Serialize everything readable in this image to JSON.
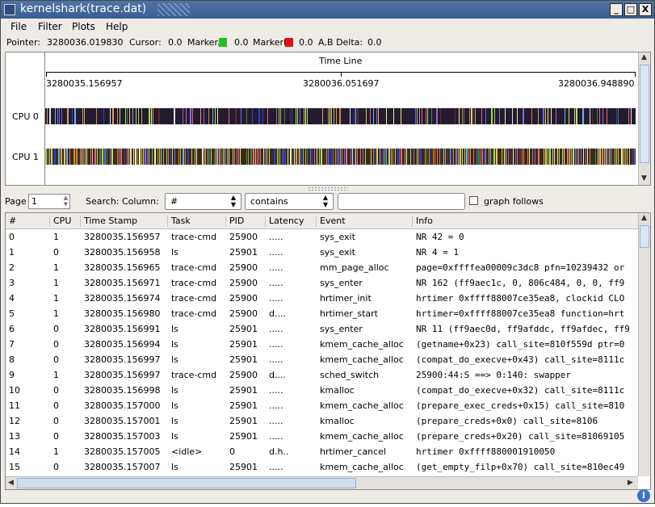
{
  "window": {
    "title": "kernelshark(trace.dat)",
    "minimize": "_",
    "maximize": "□",
    "close": "X"
  },
  "menu": [
    "File",
    "Filter",
    "Plots",
    "Help"
  ],
  "info": {
    "pointer_label": "Pointer:",
    "pointer_value": "3280036.019830",
    "cursor_label": "Cursor:",
    "cursor_value": "0.0",
    "marker_a_label": "MarkerA:",
    "marker_a_value": "0.0",
    "marker_a_color": "#1ec21e",
    "marker_b_label": "MarkerB:",
    "marker_b_value": "0.0",
    "marker_b_color": "#e01010",
    "delta_label": "A,B Delta:",
    "delta_value": "0.0"
  },
  "graph": {
    "timeline_title": "Time Line",
    "ticks": [
      "3280035.156957",
      "3280036.051697",
      "3280036.948890"
    ],
    "cpus": [
      "CPU 0",
      "CPU 1"
    ],
    "cpu0_background": "#241b2e",
    "palette": [
      "#e0c36a",
      "#a8d84c",
      "#d86a8c",
      "#6ab8e0",
      "#f0f0a0",
      "#2d3fcf",
      "#c9a46a",
      "#8a6ad8",
      "#e7e0e0",
      "#5e2a36",
      "#b0e070",
      "#d08a3a",
      "#3a8a4a",
      "#f06a6a",
      "#6a6af0"
    ]
  },
  "search": {
    "page_label": "Page",
    "page_value": "1",
    "search_label": "Search: Column:",
    "column_value": "#",
    "operator_value": "contains",
    "text_value": "",
    "graph_follows_label": "graph follows"
  },
  "table": {
    "headers": [
      "#",
      "CPU",
      "Time Stamp",
      "Task",
      "PID",
      "Latency",
      "Event",
      "Info"
    ],
    "rows": [
      [
        "0",
        "1",
        "3280035.156957",
        "trace-cmd",
        "25900",
        ".....",
        "sys_exit",
        "NR 42 = 0"
      ],
      [
        "1",
        "0",
        "3280035.156958",
        "ls",
        "25901",
        ".....",
        "sys_exit",
        "NR 4 = 1"
      ],
      [
        "2",
        "1",
        "3280035.156965",
        "trace-cmd",
        "25900",
        ".....",
        "mm_page_alloc",
        "page=0xffffea00009c3dc8 pfn=10239432 or"
      ],
      [
        "3",
        "1",
        "3280035.156971",
        "trace-cmd",
        "25900",
        ".....",
        "sys_enter",
        "NR 162 (ff9aec1c, 0, 806c484, 0, 0, ff9"
      ],
      [
        "4",
        "1",
        "3280035.156974",
        "trace-cmd",
        "25900",
        ".....",
        "hrtimer_init",
        "hrtimer 0xffff88007ce35ea8, clockid CLO"
      ],
      [
        "5",
        "1",
        "3280035.156980",
        "trace-cmd",
        "25900",
        "d....",
        "hrtimer_start",
        "hrtimer=0xffff88007ce35ea8 function=hrt"
      ],
      [
        "6",
        "0",
        "3280035.156991",
        "ls",
        "25901",
        ".....",
        "sys_enter",
        "NR 11 (ff9aec0d, ff9afddc, ff9afdec, ff9"
      ],
      [
        "7",
        "0",
        "3280035.156994",
        "ls",
        "25901",
        ".....",
        "kmem_cache_alloc",
        "(getname+0x23) call_site=810f559d ptr=0"
      ],
      [
        "8",
        "0",
        "3280035.156997",
        "ls",
        "25901",
        ".....",
        "kmem_cache_alloc",
        "(compat_do_execve+0x43) call_site=8111c"
      ],
      [
        "9",
        "1",
        "3280035.156997",
        "trace-cmd",
        "25900",
        "d....",
        "sched_switch",
        "25900:44:S ==> 0:140: swapper"
      ],
      [
        "10",
        "0",
        "3280035.156998",
        "ls",
        "25901",
        ".....",
        "kmalloc",
        "(compat_do_execve+0x32) call_site=8111c"
      ],
      [
        "11",
        "0",
        "3280035.157000",
        "ls",
        "25901",
        ".....",
        "kmem_cache_alloc",
        "(prepare_exec_creds+0x15) call_site=810"
      ],
      [
        "12",
        "0",
        "3280035.157001",
        "ls",
        "25901",
        ".....",
        "kmalloc",
        "(prepare_creds+0x0) call_site=8106"
      ],
      [
        "13",
        "0",
        "3280035.157003",
        "ls",
        "25901",
        ".....",
        "kmem_cache_alloc",
        "(prepare_creds+0x20) call_site=81069105"
      ],
      [
        "14",
        "1",
        "3280035.157005",
        "<idle>",
        "0",
        "d.h..",
        "hrtimer_cancel",
        "hrtimer 0xffff880001910050"
      ],
      [
        "15",
        "0",
        "3280035.157007",
        "ls",
        "25901",
        ".....",
        "kmem_cache_alloc",
        "(get_empty_filp+0x70) call_site=810ec49"
      ]
    ]
  }
}
